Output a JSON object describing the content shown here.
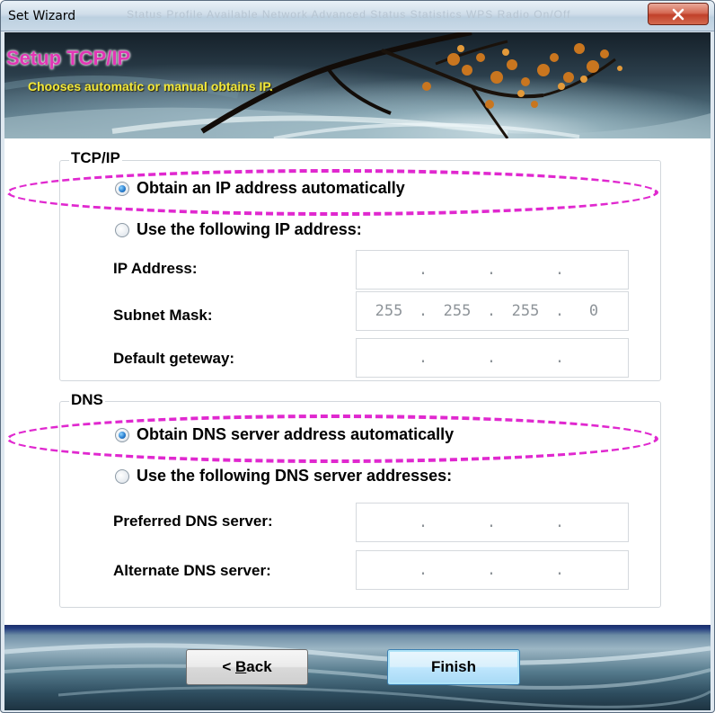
{
  "window": {
    "title": "Set Wizard",
    "ghost_tabs": "Status    Profile    Available Network    Advanced    Status    Statistics    WPS    Radio On/Off"
  },
  "banner": {
    "title": "Setup TCP/IP",
    "subtitle": "Chooses automatic or manual obtains IP."
  },
  "tcpip": {
    "group_label": "TCP/IP",
    "auto_label": "Obtain an IP address automatically",
    "manual_label": "Use the following IP address:",
    "auto_selected": true,
    "fields": {
      "ip_address": {
        "label": "IP Address:",
        "octets": [
          "",
          "",
          "",
          ""
        ]
      },
      "subnet_mask": {
        "label": "Subnet Mask:",
        "octets": [
          "255",
          "255",
          "255",
          "0"
        ]
      },
      "default_gateway": {
        "label": "Default geteway:",
        "octets": [
          "",
          "",
          "",
          ""
        ]
      }
    }
  },
  "dns": {
    "group_label": "DNS",
    "auto_label": "Obtain DNS server address automatically",
    "manual_label": "Use the following DNS server addresses:",
    "auto_selected": true,
    "fields": {
      "preferred": {
        "label": "Preferred DNS server:",
        "octets": [
          "",
          "",
          "",
          ""
        ]
      },
      "alternate": {
        "label": "Alternate DNS server:",
        "octets": [
          "",
          "",
          "",
          ""
        ]
      }
    }
  },
  "buttons": {
    "back_prefix": "< ",
    "back_mnemonic": "B",
    "back_rest": "ack",
    "finish": "Finish"
  },
  "colors": {
    "banner_title": "#e236b5",
    "banner_subtitle": "#f2e83a",
    "highlight": "#e028cf",
    "close_button": "#c0402a"
  }
}
